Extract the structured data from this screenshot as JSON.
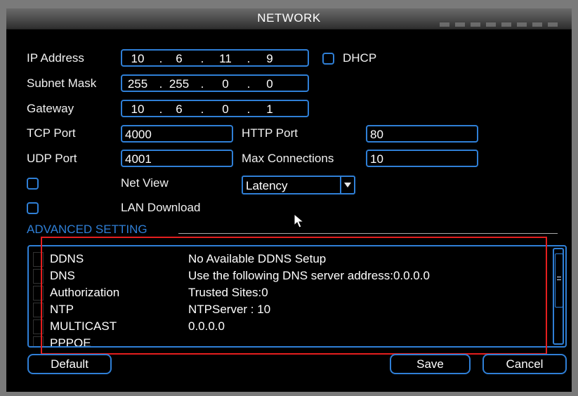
{
  "window": {
    "title": "NETWORK"
  },
  "ip_address": {
    "label": "IP Address",
    "octets": [
      "10",
      "6",
      "11",
      "9"
    ]
  },
  "dhcp": {
    "label": "DHCP",
    "checked": false
  },
  "subnet_mask": {
    "label": "Subnet Mask",
    "octets": [
      "255",
      "255",
      "0",
      "0"
    ]
  },
  "gateway": {
    "label": "Gateway",
    "octets": [
      "10",
      "6",
      "0",
      "1"
    ]
  },
  "tcp_port": {
    "label": "TCP Port",
    "value": "4000"
  },
  "http_port": {
    "label": "HTTP Port",
    "value": "80"
  },
  "udp_port": {
    "label": "UDP Port",
    "value": "4001"
  },
  "max_connections": {
    "label": "Max Connections",
    "value": "10"
  },
  "net_view": {
    "label": "Net View",
    "checked": false
  },
  "transfer_policy": {
    "selected": "Latency"
  },
  "lan_download": {
    "label": "LAN Download",
    "checked": false
  },
  "advanced": {
    "title": "ADVANCED SETTING",
    "rows": [
      {
        "name": "DDNS",
        "value": "No Available DDNS Setup"
      },
      {
        "name": "DNS",
        "value": "Use the following DNS server address:0.0.0.0"
      },
      {
        "name": "Authorization",
        "value": "Trusted Sites:0"
      },
      {
        "name": "NTP",
        "value": "NTPServer : 10"
      },
      {
        "name": "MULTICAST",
        "value": "0.0.0.0"
      },
      {
        "name": "PPPOE",
        "value": ""
      }
    ]
  },
  "buttons": {
    "default": "Default",
    "save": "Save",
    "cancel": "Cancel"
  },
  "colors": {
    "accent": "#2f7fd6",
    "highlight_box": "#e41e1e",
    "background": "#000000"
  }
}
